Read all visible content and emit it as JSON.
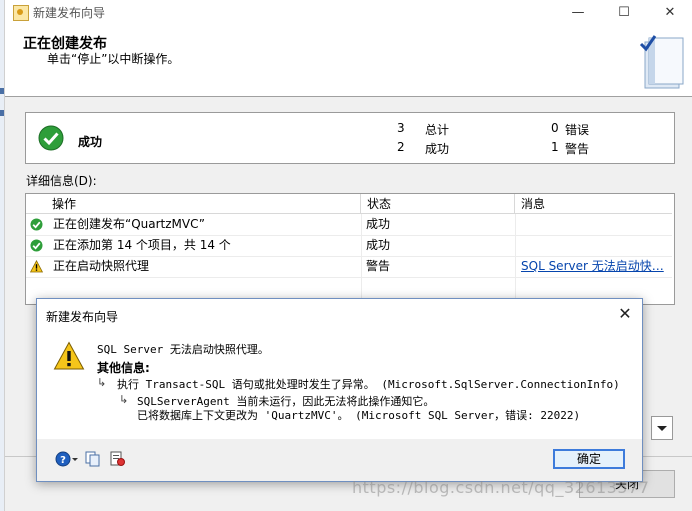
{
  "window": {
    "title": "新建发布向导",
    "minimize_glyph": "—",
    "maximize_glyph": "☐",
    "close_glyph": "✕"
  },
  "header": {
    "title": "正在创建发布",
    "subtitle": "单击“停止”以中断操作。"
  },
  "status": {
    "label": "成功",
    "total_count": "3",
    "total_label": "总计",
    "success_count": "2",
    "success_label": "成功",
    "error_count": "0",
    "error_label": "错误",
    "warning_count": "1",
    "warning_label": "警告"
  },
  "details": {
    "label": "详细信息(D):",
    "columns": {
      "action": "操作",
      "status": "状态",
      "message": "消息"
    },
    "rows": [
      {
        "icon": "success-icon",
        "action": "正在创建发布“QuartzMVC”",
        "status": "成功",
        "message": ""
      },
      {
        "icon": "success-icon",
        "action": "正在添加第 14 个项目，共 14 个",
        "status": "成功",
        "message": ""
      },
      {
        "icon": "warning-icon",
        "action": "正在启动快照代理",
        "status": "警告",
        "message": "SQL Server 无法启动快…"
      }
    ]
  },
  "background": {
    "close_label": "关闭"
  },
  "dialog": {
    "title": "新建发布向导",
    "close_glyph": "✕",
    "message": "SQL Server 无法启动快照代理。",
    "additional_info_title": "其他信息:",
    "info_line1": "执行 Transact-SQL 语句或批处理时发生了异常。 (Microsoft.SqlServer.ConnectionInfo)",
    "info_line2": "SQLServerAgent 当前未运行，因此无法将此操作通知它。",
    "info_line3": "已将数据库上下文更改为 'QuartzMVC'。 (Microsoft SQL Server，错误: 22022)",
    "ok_label": "确定"
  },
  "watermark": "https://blog.csdn.net/qq_32613577"
}
